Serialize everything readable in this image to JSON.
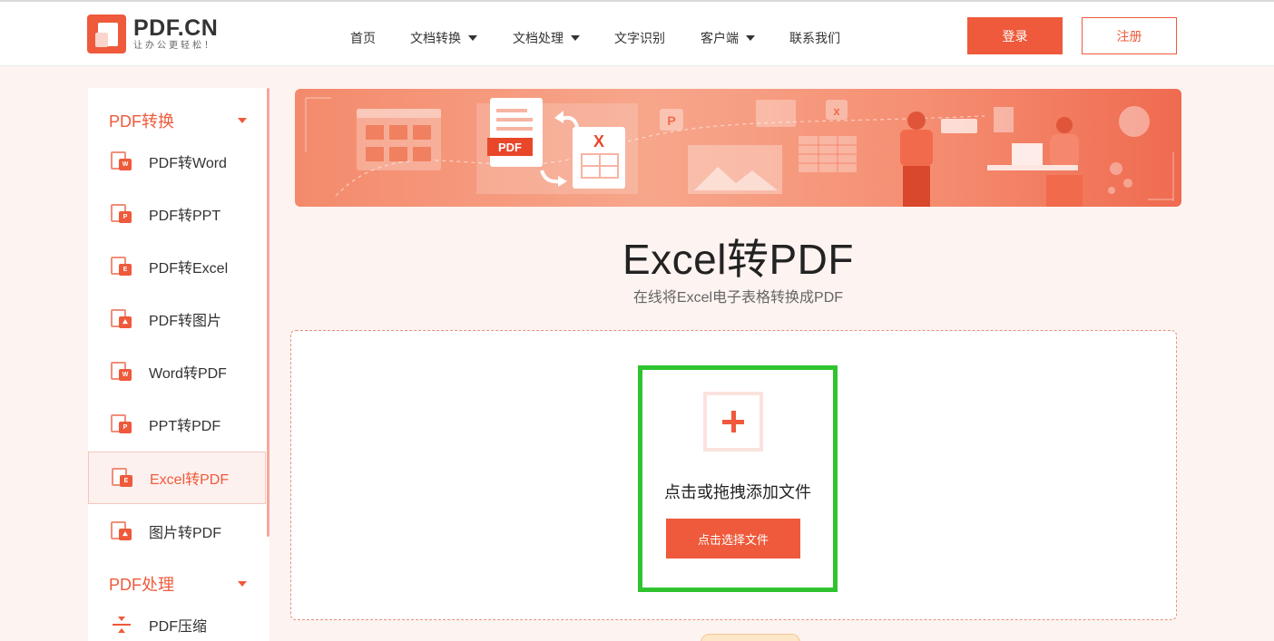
{
  "brand": {
    "name": "PDF.CN",
    "slogan": "让办公更轻松！",
    "accent": "#ee5a3b"
  },
  "nav": {
    "items": [
      {
        "label": "首页",
        "dropdown": false
      },
      {
        "label": "文档转换",
        "dropdown": true
      },
      {
        "label": "文档处理",
        "dropdown": true
      },
      {
        "label": "文字识别",
        "dropdown": false
      },
      {
        "label": "客户端",
        "dropdown": true
      },
      {
        "label": "联系我们",
        "dropdown": false
      }
    ],
    "login": "登录",
    "register": "注册"
  },
  "sidebar": {
    "cat1": "PDF转换",
    "items": [
      {
        "label": "PDF转Word",
        "badge": "W"
      },
      {
        "label": "PDF转PPT",
        "badge": "P"
      },
      {
        "label": "PDF转Excel",
        "badge": "E"
      },
      {
        "label": "PDF转图片",
        "badge": "⛰"
      },
      {
        "label": "Word转PDF",
        "badge": "W"
      },
      {
        "label": "PPT转PDF",
        "badge": "P"
      },
      {
        "label": "Excel转PDF",
        "badge": "E",
        "active": true
      },
      {
        "label": "图片转PDF",
        "badge": "⛰"
      }
    ],
    "cat2": "PDF处理",
    "compress": "PDF压缩"
  },
  "banner": {
    "pdf_label": "PDF",
    "excel_mark": "X",
    "p_mark": "P",
    "x_mark": "x"
  },
  "main": {
    "title": "Excel转PDF",
    "subtitle": "在线将Excel电子表格转换成PDF",
    "upload_hint": "点击或拖拽添加文件",
    "select_button": "点击选择文件"
  }
}
